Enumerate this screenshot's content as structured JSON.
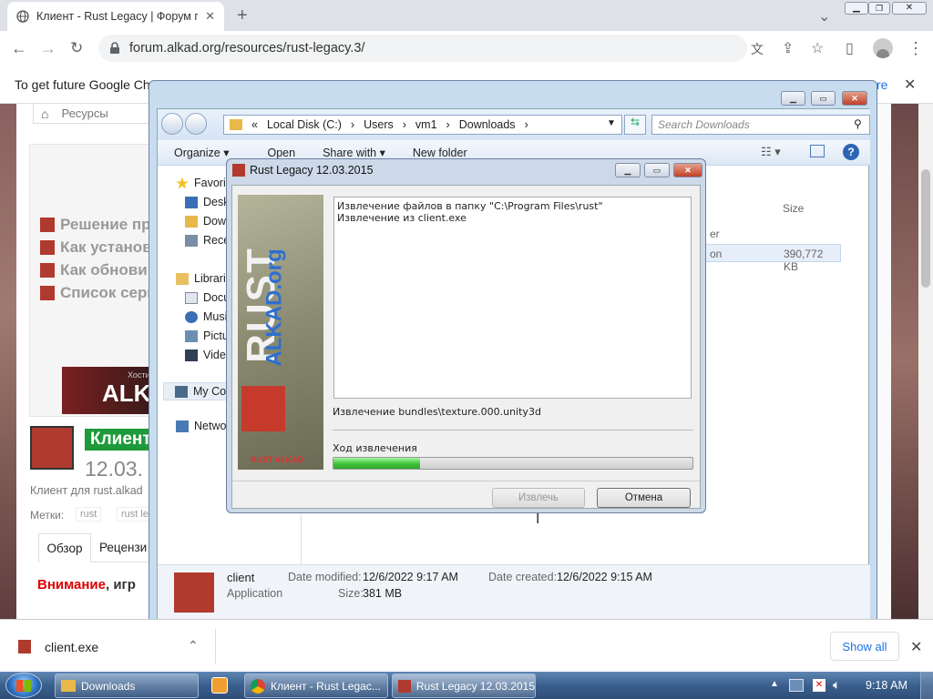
{
  "browser": {
    "tab_title": "Клиент - Rust Legacy | Форум пр",
    "url": "forum.alkad.org/resources/rust-legacy.3/",
    "infobar_text": "To get future Google Chro",
    "infobar_link": "re",
    "icons": [
      "globe-icon",
      "close-icon",
      "plus-icon",
      "chevron-down-icon",
      "minimize-icon",
      "restore-icon",
      "back-icon",
      "forward-icon",
      "reload-icon",
      "lock-icon",
      "translate-icon",
      "share-icon",
      "star-icon",
      "sidebar-icon",
      "profile-icon",
      "more-icon"
    ]
  },
  "webpage": {
    "breadcrumb": "Ресурсы",
    "sidebar_links": [
      "Решение пр",
      "Как установ",
      "Как обнови",
      "Список серв"
    ],
    "banner_small": "Хости",
    "banner_big": "ALK",
    "title_badge": "Клиент",
    "date": "12.03.",
    "subtitle": "Клиент для rust.alkad",
    "tags_label": "Метки:",
    "tags": [
      "rust",
      "rust le"
    ],
    "tabs": [
      "Обзор",
      "Рецензи"
    ],
    "warning_bold": "Внимание",
    "warning_rest": ", игр"
  },
  "explorer": {
    "breadcrumb": [
      "«",
      "Local Disk (C:)",
      "›",
      "Users",
      "›",
      "vm1",
      "›",
      "Downloads",
      "›"
    ],
    "search_placeholder": "Search Downloads",
    "commands": [
      "Organize ▾",
      "Open",
      "Share with ▾",
      "New folder"
    ],
    "nav": [
      {
        "label": "Favorit",
        "color": "#f0c020"
      },
      {
        "label": "Desk",
        "color": "#3b6eb5"
      },
      {
        "label": "Dowr",
        "color": "#e8b84a"
      },
      {
        "label": "Rece",
        "color": "#7a8fa6"
      },
      {
        "label": "Librari",
        "color": "#e8c060"
      },
      {
        "label": "Docu",
        "color": "#dfe7f0"
      },
      {
        "label": "Musi",
        "color": "#3b6eb5"
      },
      {
        "label": "Pictu",
        "color": "#6b8fb0"
      },
      {
        "label": "Vide",
        "color": "#2f3f55"
      },
      {
        "label": "My Co",
        "color": "#4a6a8a"
      },
      {
        "label": "Netwo",
        "color": "#4a7ab5"
      }
    ],
    "column_size": "Size",
    "column_partial": "er",
    "file_type_partial": "on",
    "file_size": "390,772 KB",
    "details": {
      "name": "client",
      "type": "Application",
      "date_modified_label": "Date modified:",
      "date_modified": "12/6/2022 9:17 AM",
      "date_created_label": "Date created:",
      "date_created": "12/6/2022 9:15 AM",
      "size_label": "Size:",
      "size": "381 MB"
    }
  },
  "dialog": {
    "title": "Rust Legacy 12.03.2015",
    "log_lines": [
      "Извлечение файлов в папку \"C:\\Program Files\\rust\"",
      "Извлечение из client.exe"
    ],
    "current_file": "Извлечение bundles\\texture.000.unity3d",
    "progress_label": "Ход извлечения",
    "progress": 0.24,
    "extract_button": "Извлечь",
    "cancel_button": "Отмена",
    "side_image_text1": "RUST",
    "side_image_text2": "ALKAD.org",
    "side_image_footer": "RUST ALKAD"
  },
  "downloads": {
    "file": "client.exe",
    "show_all": "Show all"
  },
  "taskbar": {
    "items": [
      "Downloads",
      "Клиент - Rust Legac...",
      "Rust Legacy 12.03.2015"
    ],
    "clock": "9:18 AM"
  }
}
